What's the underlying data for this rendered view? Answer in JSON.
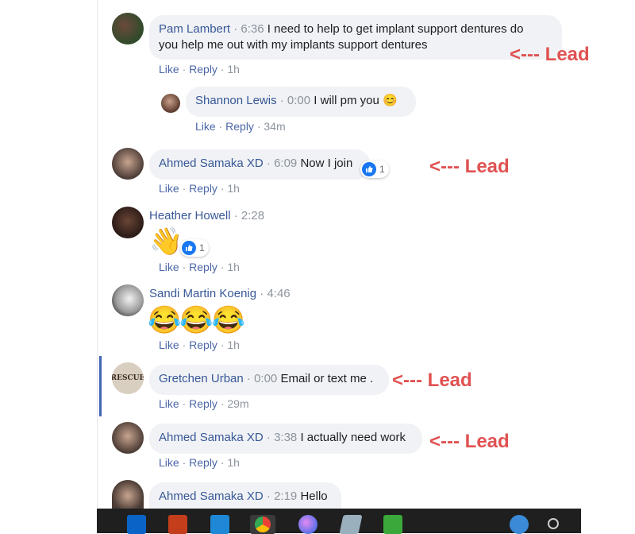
{
  "comments": [
    {
      "name": "Pam Lambert",
      "time": "6:36",
      "text1": "I need to help to get implant support dentures do",
      "text2": "you help me out with my implants support dentures",
      "actions": {
        "like": "Like",
        "reply": "Reply",
        "age": "1h"
      }
    },
    {
      "name": "Shannon Lewis",
      "time": "0:00",
      "text": "I will pm you",
      "emoji": "😊",
      "actions": {
        "like": "Like",
        "reply": "Reply",
        "age": "34m"
      }
    },
    {
      "name": "Ahmed Samaka XD",
      "time": "6:09",
      "text": "Now I join",
      "reactions": "1",
      "actions": {
        "like": "Like",
        "reply": "Reply",
        "age": "1h"
      }
    },
    {
      "name": "Heather Howell",
      "time": "2:28",
      "emoji": "👋",
      "reactions": "1",
      "actions": {
        "like": "Like",
        "reply": "Reply",
        "age": "1h"
      }
    },
    {
      "name": "Sandi Martin Koenig",
      "time": "4:46",
      "emoji": "😂😂😂",
      "actions": {
        "like": "Like",
        "reply": "Reply",
        "age": "1h"
      }
    },
    {
      "name": "Gretchen Urban",
      "time": "0:00",
      "text": "Email or text me .",
      "avatar_text": "RESCUE",
      "actions": {
        "like": "Like",
        "reply": "Reply",
        "age": "29m"
      }
    },
    {
      "name": "Ahmed Samaka XD",
      "time": "3:38",
      "text": "I actually need work",
      "actions": {
        "like": "Like",
        "reply": "Reply",
        "age": "1h"
      }
    },
    {
      "name": "Ahmed Samaka XD",
      "time": "2:19",
      "text": "Hello"
    }
  ],
  "annotations": {
    "lead": "<--- Lead"
  },
  "colors": {
    "name": "#385898",
    "lead": "#e05252",
    "bubble": "#f0f2f5",
    "like": "#1877f2"
  }
}
